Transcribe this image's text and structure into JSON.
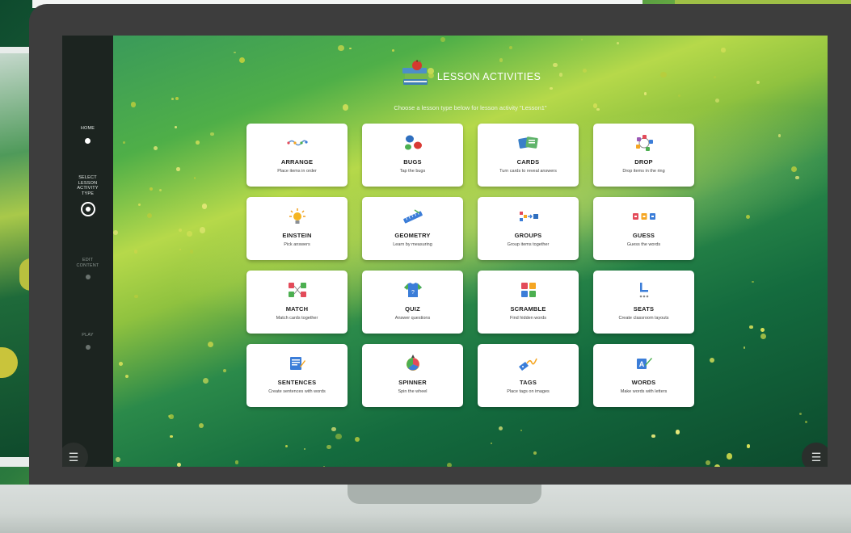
{
  "sidebar": {
    "steps": [
      {
        "label": "HOME",
        "state": "done"
      },
      {
        "label": "SELECT LESSON ACTIVITY TYPE",
        "state": "active"
      },
      {
        "label": "EDIT CONTENT",
        "state": "pending"
      },
      {
        "label": "PLAY",
        "state": "pending"
      }
    ],
    "menu_icon": "☰"
  },
  "header": {
    "title": "LESSON ACTIVITIES",
    "subtitle": "Choose a lesson type below for lesson activity \"Lesson1\"",
    "logo_icon": "books-apple-icon"
  },
  "activities": [
    {
      "name": "ARRANGE",
      "desc": "Place items in order",
      "icon": "arrange-icon"
    },
    {
      "name": "BUGS",
      "desc": "Tap the bugs",
      "icon": "bugs-icon"
    },
    {
      "name": "CARDS",
      "desc": "Turn cards to reveal answers",
      "icon": "cards-icon"
    },
    {
      "name": "DROP",
      "desc": "Drop items in the ring",
      "icon": "drop-icon"
    },
    {
      "name": "EINSTEIN",
      "desc": "Pick answers",
      "icon": "lightbulb-icon"
    },
    {
      "name": "GEOMETRY",
      "desc": "Learn by measuring",
      "icon": "ruler-icon"
    },
    {
      "name": "GROUPS",
      "desc": "Group items together",
      "icon": "groups-icon"
    },
    {
      "name": "GUESS",
      "desc": "Guess the words",
      "icon": "guess-icon"
    },
    {
      "name": "MATCH",
      "desc": "Match cards together",
      "icon": "match-icon"
    },
    {
      "name": "QUIZ",
      "desc": "Answer questions",
      "icon": "quiz-shirt-icon"
    },
    {
      "name": "SCRAMBLE",
      "desc": "Find hidden words",
      "icon": "scramble-icon"
    },
    {
      "name": "SEATS",
      "desc": "Create classroom layouts",
      "icon": "seats-icon"
    },
    {
      "name": "SENTENCES",
      "desc": "Create sentences with words",
      "icon": "sentences-icon"
    },
    {
      "name": "SPINNER",
      "desc": "Spin the wheel",
      "icon": "spinner-icon"
    },
    {
      "name": "TAGS",
      "desc": "Place tags on images",
      "icon": "tags-icon"
    },
    {
      "name": "WORDS",
      "desc": "Make words with letters",
      "icon": "words-icon"
    }
  ],
  "colors": {
    "sidebar": "#1c2420",
    "card": "#ffffff",
    "accent_green": "#4faf48",
    "accent_yellow": "#c9c43b"
  }
}
